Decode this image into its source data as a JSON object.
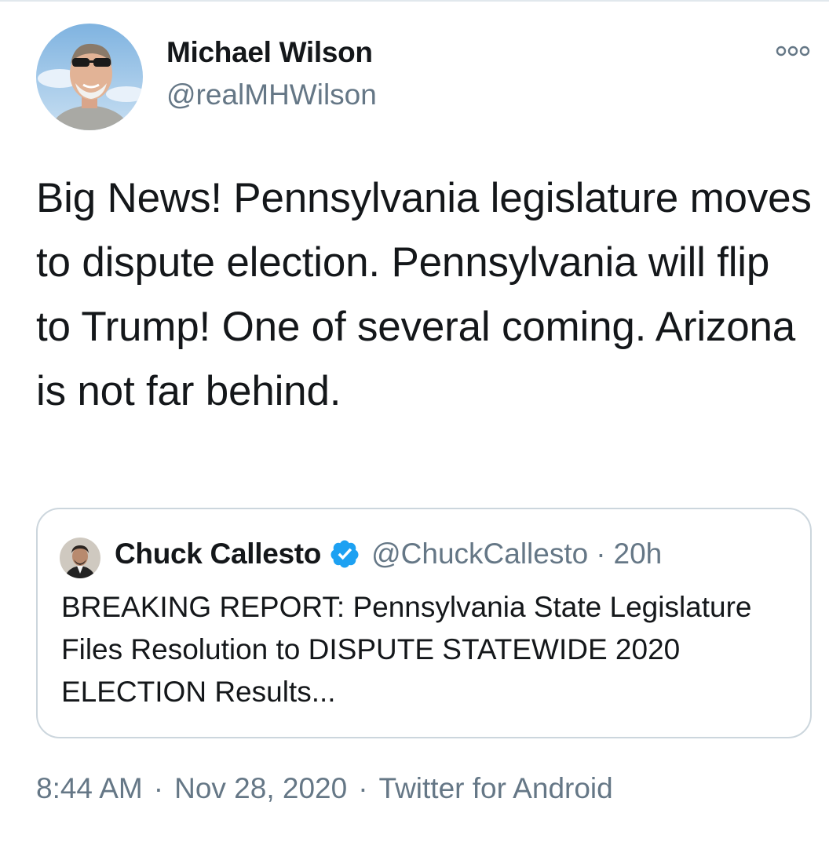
{
  "author": {
    "name": "Michael Wilson",
    "handle": "@realMHWilson"
  },
  "tweet": {
    "text": "Big News! Pennsylvania legislature moves to dispute election. Pennsylvania will flip to Trump! One of several coming. Arizona is not far behind."
  },
  "quote": {
    "name": "Chuck Callesto",
    "handle": "@ChuckCallesto",
    "separator": "·",
    "time": "20h",
    "verified_icon": "verified-badge-icon",
    "text": "BREAKING REPORT: Pennsylvania State Legislature Files Resolution to DISPUTE STATEWIDE 2020 ELECTION Results..."
  },
  "meta": {
    "time": "8:44 AM",
    "separator": "·",
    "date": "Nov 28, 2020",
    "source": "Twitter for Android"
  },
  "icons": {
    "more": "more-options-icon"
  },
  "colors": {
    "text": "#14171a",
    "secondary": "#657786",
    "border": "#ccd6dd",
    "verified": "#1da1f2"
  }
}
